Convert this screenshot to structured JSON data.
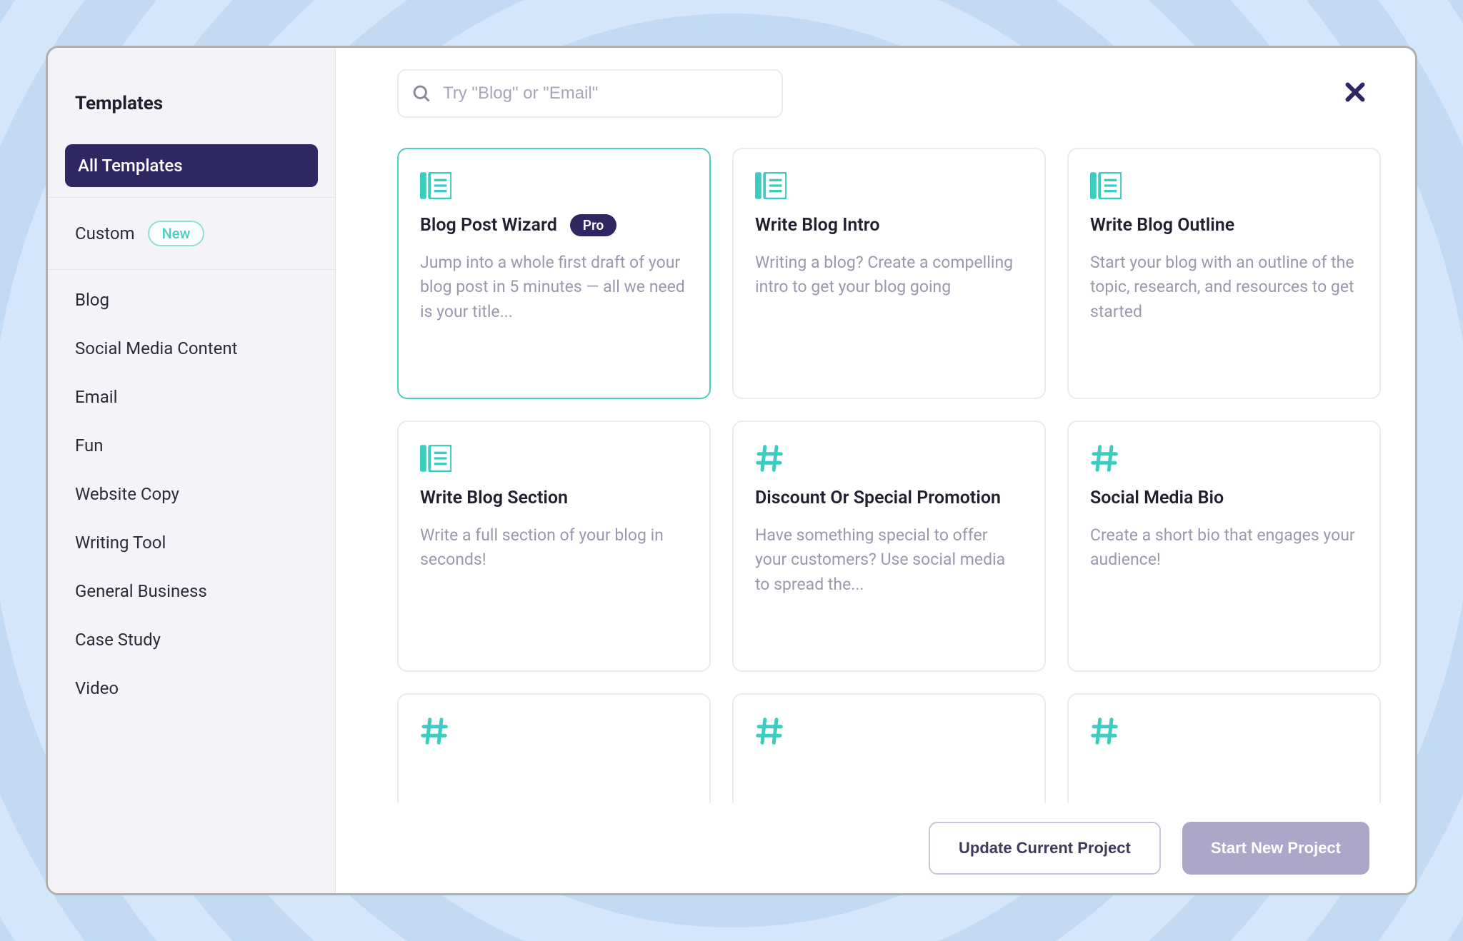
{
  "sidebar": {
    "title": "Templates",
    "items": [
      {
        "label": "All Templates",
        "active": true
      },
      {
        "label": "Custom",
        "badge": "New",
        "separator_before": true,
        "separator_after": true
      },
      {
        "label": "Blog"
      },
      {
        "label": "Social Media Content"
      },
      {
        "label": "Email"
      },
      {
        "label": "Fun"
      },
      {
        "label": "Website Copy"
      },
      {
        "label": "Writing Tool"
      },
      {
        "label": "General Business"
      },
      {
        "label": "Case Study"
      },
      {
        "label": "Video"
      }
    ]
  },
  "search": {
    "placeholder": "Try \"Blog\" or \"Email\""
  },
  "templates": [
    {
      "icon": "doc",
      "title": "Blog Post Wizard",
      "badge": "Pro",
      "desc": "Jump into a whole first draft of your blog post in 5 minutes — all we need is your title...",
      "selected": true
    },
    {
      "icon": "doc",
      "title": "Write Blog Intro",
      "desc": "Writing a blog? Create a compelling intro to get your blog going"
    },
    {
      "icon": "doc",
      "title": "Write Blog Outline",
      "desc": "Start your blog with an outline of the topic, research, and resources to get started"
    },
    {
      "icon": "doc",
      "title": "Write Blog Section",
      "desc": "Write a full section of your blog in seconds!"
    },
    {
      "icon": "hash",
      "title": "Discount Or Special Promotion",
      "desc": "Have something special to offer your customers? Use social media to spread the..."
    },
    {
      "icon": "hash",
      "title": "Social Media Bio",
      "desc": "Create a short bio that engages your audience!"
    },
    {
      "icon": "hash",
      "title": "",
      "desc": ""
    },
    {
      "icon": "hash",
      "title": "",
      "desc": ""
    },
    {
      "icon": "hash",
      "title": "",
      "desc": ""
    }
  ],
  "footer": {
    "secondary": "Update Current Project",
    "primary": "Start New Project"
  }
}
